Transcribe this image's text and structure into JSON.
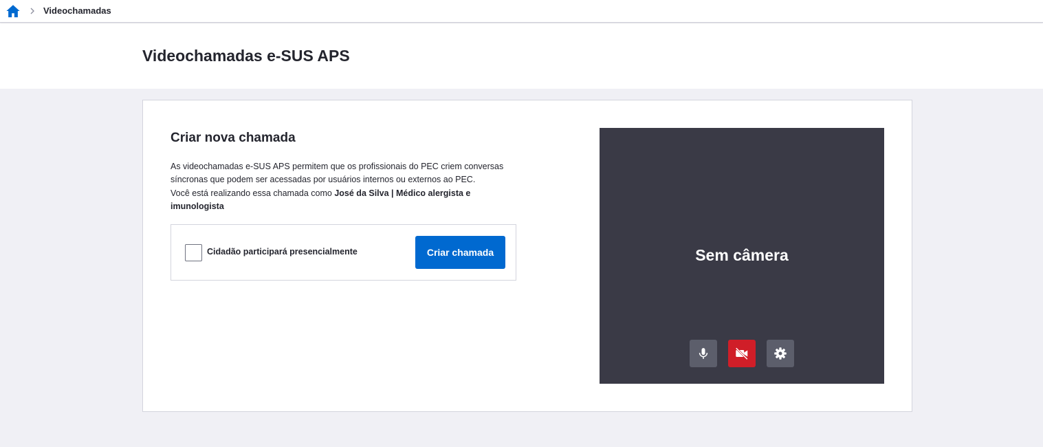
{
  "breadcrumb": {
    "home_icon": "home-icon",
    "separator_icon": "chevron-right-icon",
    "current": "Videochamadas"
  },
  "page": {
    "title": "Videochamadas e-SUS APS"
  },
  "create_call": {
    "title": "Criar nova chamada",
    "description_line1": "As videochamadas e-SUS APS permitem que os profissionais do PEC criem conversas síncronas que podem ser acessadas por usuários internos ou externos ao PEC.",
    "description_prefix": "Você está realizando essa chamada como ",
    "user_info": "José da Silva | Médico alergista e imunologista",
    "checkbox_label": "Cidadão participará presencialmente",
    "checkbox_checked": false,
    "button_label": "Criar chamada"
  },
  "video": {
    "status_text": "Sem câmera",
    "controls": [
      {
        "name": "microphone-icon",
        "state": "on"
      },
      {
        "name": "camera-off-icon",
        "state": "off"
      },
      {
        "name": "gear-icon",
        "state": "default"
      }
    ]
  },
  "colors": {
    "primary": "#0069d0",
    "danger": "#d01e28",
    "video_bg": "#3a3a46",
    "control_bg": "#5c5e6b",
    "page_bg": "#f0f0f5"
  }
}
